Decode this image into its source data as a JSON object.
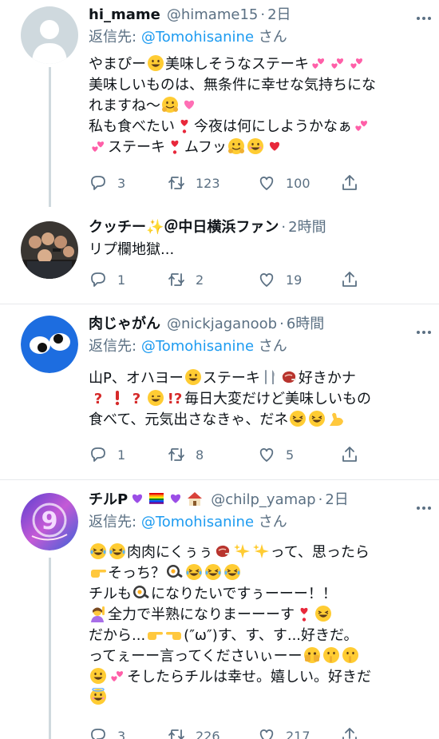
{
  "tweets": [
    {
      "name": "hi_mame",
      "handle": "@himame15",
      "time": "2日",
      "reply_prefix": "返信先:",
      "reply_mention": "@Tomohisanine",
      "reply_suffix": "さん",
      "lines": [
        [
          "やまぴー",
          "😃",
          "美味しそうなステーキ",
          "💕",
          "💕",
          "💕"
        ],
        [
          "美味しいものは、無条件に幸せな気持ちにな"
        ],
        [
          "れますね〜",
          "🤗",
          "💗"
        ],
        [
          "私も食べたい",
          "❣️",
          "今夜は何にしようかなぁ",
          "💕"
        ],
        [
          "💕",
          "ステーキ",
          "❣️",
          "ムフッ",
          "🤗",
          "😊",
          "❤️"
        ]
      ],
      "replies": "3",
      "retweets": "123",
      "likes": "100"
    },
    {
      "name": "クッチー✨＠中日横浜ファン",
      "time": "2時間",
      "lines": [
        [
          "リプ欄地獄..."
        ]
      ],
      "replies": "1",
      "retweets": "2",
      "likes": "19"
    },
    {
      "name": "肉じゃがん",
      "handle": "@nickjaganoob",
      "time": "6時間",
      "reply_prefix": "返信先:",
      "reply_mention": "@Tomohisanine",
      "reply_suffix": "さん",
      "lines": [
        [
          "山P、オハヨー",
          "😄",
          "ステーキ",
          "🍴",
          "🥩",
          "好きかナ"
        ],
        [
          "❓",
          "❗",
          "❓",
          "😜",
          "⁉️",
          "毎日大変だけど美味しいもの"
        ],
        [
          "食べて、元気出さなきゃ、だネ",
          "😆",
          "😆",
          "💪"
        ]
      ],
      "replies": "1",
      "retweets": "8",
      "likes": "5"
    },
    {
      "name": "チルP",
      "name_emoji": [
        "💜",
        "🏳️‍🌈",
        "💜",
        "🏠"
      ],
      "handle": "@chilp_yamap",
      "time": "2日",
      "reply_prefix": "返信先:",
      "reply_mention": "@Tomohisanine",
      "reply_suffix": "さん",
      "lines": [
        [
          "🤣",
          "🤣",
          "肉肉にくぅぅ",
          "🥩",
          "✨",
          "✨",
          "って、思ったら"
        ],
        [
          "👉",
          "そっち？",
          "🍳",
          "😂",
          "🤣",
          "🤣"
        ],
        [
          "チルも",
          "🍳",
          "になりたいですぅーーー！！"
        ],
        [
          "🙋‍♀️",
          "全力で半熟になりまーーーす",
          "❣️",
          "😆"
        ],
        [
          "だから...",
          "👉",
          "👈",
          "(″ω″)す、す、す...好きだ。"
        ],
        [
          "ってぇーー言ってくださいぃーー",
          "🫣",
          "🤫",
          "🤫"
        ],
        [
          "🫠",
          "💕",
          "そしたらチルは幸せ。嬉しい。好きだ"
        ],
        [
          "😇"
        ]
      ],
      "replies": "3",
      "retweets": "226",
      "likes": "217"
    }
  ],
  "icons": {
    "reply": "reply-icon",
    "retweet": "retweet-icon",
    "like": "heart-icon",
    "share": "share-icon",
    "more": "more-icon"
  },
  "colors": {
    "link": "#1d9bf0",
    "secondary": "#5b7083",
    "divider": "#e7e9ec",
    "thread": "#cfd9de"
  }
}
